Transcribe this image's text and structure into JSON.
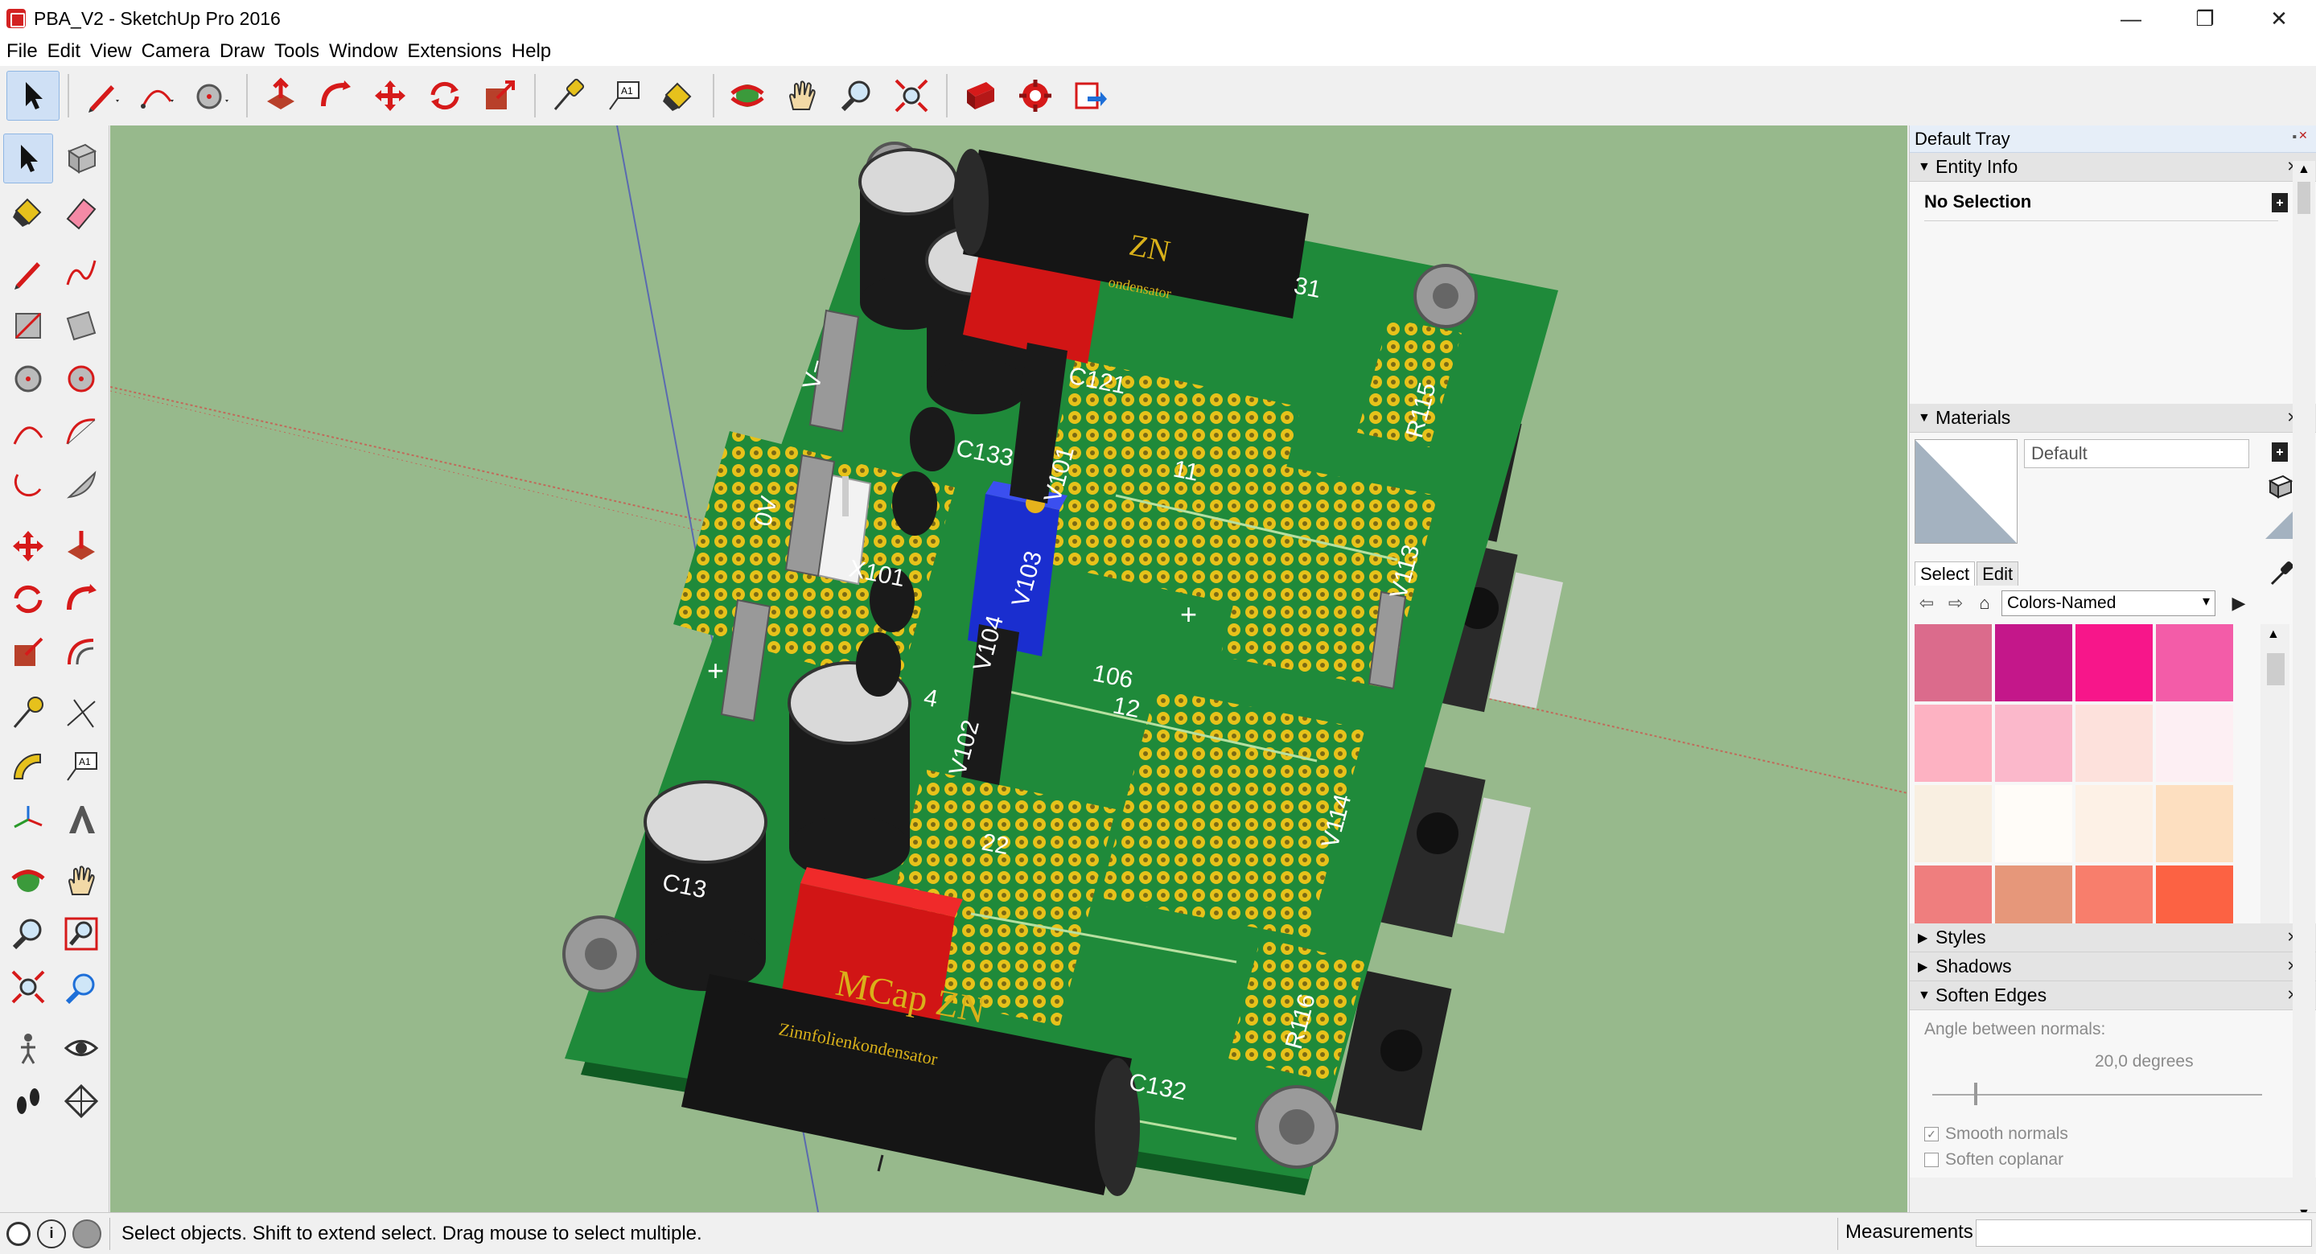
{
  "window": {
    "title": "PBA_V2 - SketchUp Pro 2016"
  },
  "menu": [
    "File",
    "Edit",
    "View",
    "Camera",
    "Draw",
    "Tools",
    "Window",
    "Extensions",
    "Help"
  ],
  "scene": {
    "labels": {
      "mcap_top": "ZN",
      "mcap_top_sub": "ondensator",
      "c121": "C121",
      "c133": "C133",
      "c131": "31",
      "v_minus": "V−",
      "zero_v": "0V",
      "x101": "X101",
      "v103": "V103",
      "v101": "V101",
      "v102": "V102",
      "v104": "V104",
      "r115": "R115",
      "v113": "V113",
      "v114": "V114",
      "r116": "R116",
      "n11": "11",
      "n106": "106",
      "n12": "12",
      "n4": "4",
      "n22": "22",
      "plus": "+",
      "v_plus": "+",
      "c13": "C13",
      "c132": "C132",
      "mcap_bottom": "MCap ZN",
      "mcap_bottom_sub": "Zinnfolienkondensator"
    }
  },
  "tray": {
    "title": "Default Tray",
    "entity_info": {
      "title": "Entity Info",
      "selection": "No Selection"
    },
    "materials": {
      "title": "Materials",
      "name": "Default",
      "tab_select": "Select",
      "tab_edit": "Edit",
      "library": "Colors-Named",
      "swatch_colors": [
        "#db6b8c",
        "#c4178a",
        "#f7168a",
        "#f35ca8",
        "#fdb2c2",
        "#fbb8cb",
        "#fde1dc",
        "#fdeff3",
        "#f9efe1",
        "#fffcf8",
        "#fdf1e6",
        "#fddfc0",
        "#ef7e7e",
        "#e6977a",
        "#f87e6c",
        "#fc6243"
      ]
    },
    "styles": {
      "title": "Styles"
    },
    "shadows": {
      "title": "Shadows"
    },
    "soften_edges": {
      "title": "Soften Edges",
      "angle_label": "Angle between normals:",
      "angle_value": "20,0  degrees",
      "smooth_normals": "Smooth normals",
      "soften_coplanar": "Soften coplanar"
    }
  },
  "status": {
    "hint": "Select objects. Shift to extend select. Drag mouse to select multiple.",
    "measurements_label": "Measurements"
  }
}
